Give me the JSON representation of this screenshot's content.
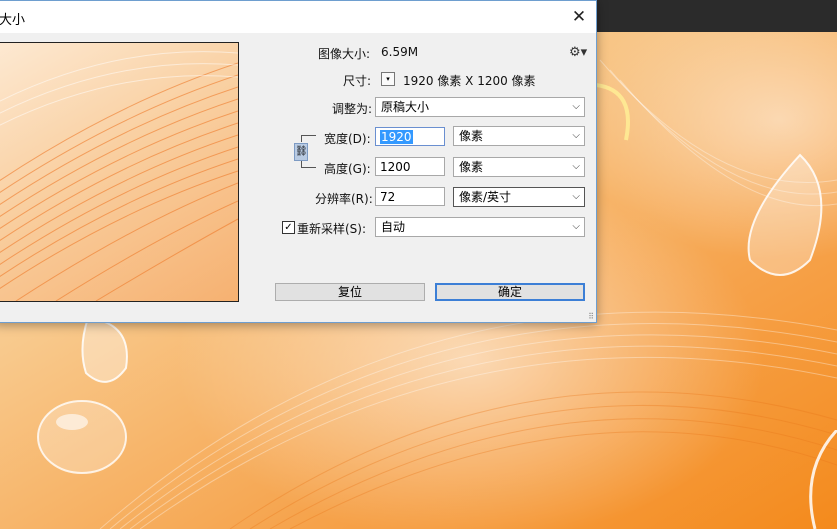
{
  "dialog": {
    "title": "大小",
    "close_glyph": "✕",
    "image_size_label": "图像大小:",
    "image_size_value": "6.59M",
    "settings_glyph": "⚙▾",
    "dimensions_label": "尺寸:",
    "dimensions_toggle_glyph": "▾",
    "dimensions_value": "1920 像素 X 1200 像素",
    "fit_to_label": "调整为:",
    "fit_to_value": "原稿大小",
    "width_label": "宽度(D):",
    "width_value": "1920",
    "width_unit": "像素",
    "height_label": "高度(G):",
    "height_value": "1200",
    "height_unit": "像素",
    "resolution_label": "分辨率(R):",
    "resolution_value": "72",
    "resolution_unit": "像素/英寸",
    "resample_label": "重新采样(S):",
    "resample_checked": true,
    "resample_check_glyph": "✓",
    "resample_value": "自动",
    "reset_button": "复位",
    "ok_button": "确定",
    "chevron_glyph": "⌵",
    "chain_glyph": "⛓",
    "grip_glyph": "⠿"
  },
  "colors": {
    "accent": "#3c7fd6",
    "selection": "#3399ff",
    "background_orange": "#f48a1c"
  }
}
